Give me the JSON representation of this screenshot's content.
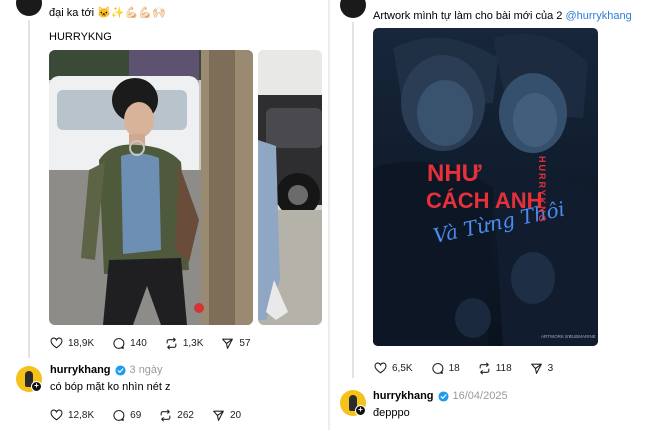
{
  "left_post": {
    "caption": "đại ka tới 🐱✨💪🏻💪🏻🙌🏻",
    "tag_line": "HURRYKNG",
    "stats": {
      "likes": "18,9K",
      "comments": "140",
      "reposts": "1,3K",
      "shares": "57"
    }
  },
  "left_reply": {
    "username": "hurrykhang",
    "time": "3 ngày",
    "text": "có bóp mặt ko nhìn nét z",
    "stats": {
      "likes": "12,8K",
      "comments": "69",
      "reposts": "262",
      "shares": "20"
    }
  },
  "right_post": {
    "caption_text": "Artwork mình tự làm cho bài mới của 2 ",
    "caption_mention": "@hurrykhang",
    "poster": {
      "title_line1": "NHƯ",
      "title_line2": "CÁCH ANH",
      "script_text": "Và Từng Thôi",
      "vertical_text": "HURRYKNG",
      "footer_left": "ARTWORK BY",
      "footer_right": "SUBMARINE"
    },
    "stats": {
      "likes": "6,5K",
      "comments": "18",
      "reposts": "118",
      "shares": "3"
    }
  },
  "right_reply": {
    "username": "hurrykhang",
    "time": "16/04/2025",
    "text": "đepppo"
  },
  "colors": {
    "verified_blue": "#1d9bf0",
    "mention_blue": "#2f7bd7",
    "poster_red": "#e8303a",
    "poster_blue": "#3d7de0",
    "avatar_yellow": "#f4c21a"
  },
  "icons": [
    "heart-icon",
    "comment-icon",
    "repost-icon",
    "share-icon",
    "verified-badge-icon",
    "follow-plus-icon"
  ]
}
